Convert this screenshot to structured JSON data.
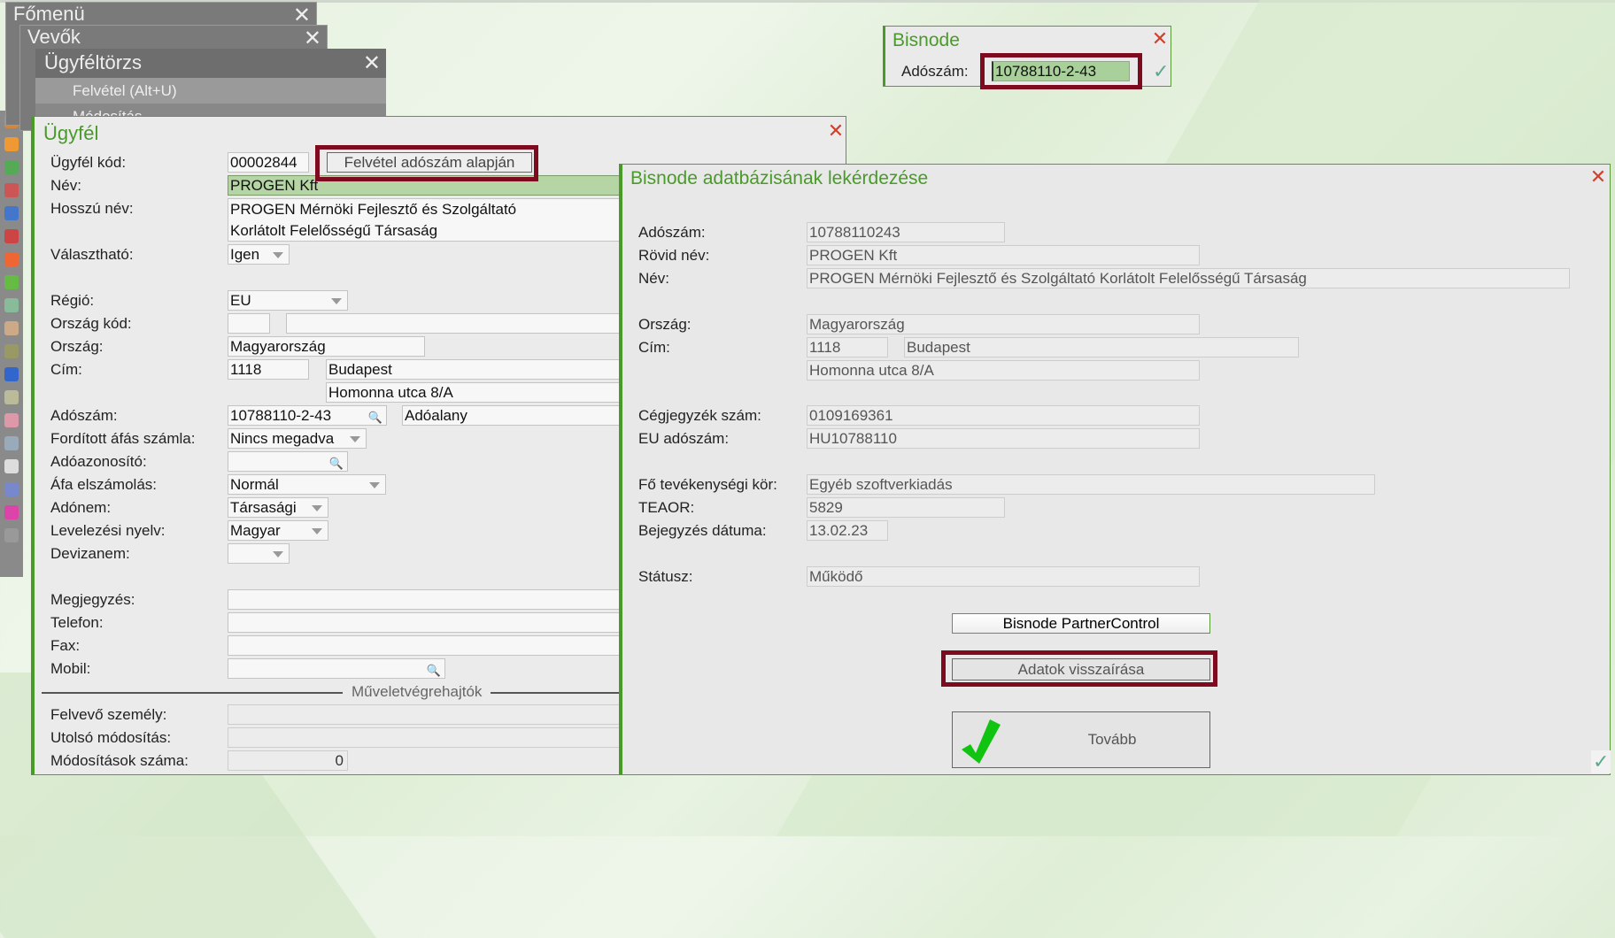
{
  "menus": {
    "main": "Főmenü",
    "customers": "Vevők",
    "registry": "Ügyféltörzs",
    "add": "Felvétel (Alt+U)",
    "edit": "Módosítás"
  },
  "client": {
    "title": "Ügyfél",
    "labels": {
      "code": "Ügyfél kód:",
      "name": "Név:",
      "long_name": "Hosszú név:",
      "selectable": "Választható:",
      "region": "Régió:",
      "country_code": "Ország kód:",
      "country": "Ország:",
      "address": "Cím:",
      "tax": "Adószám:",
      "reverse_vat": "Fordított áfás számla:",
      "tax_id": "Adóazonosító:",
      "vat_settle": "Áfa elszámolás:",
      "tax_type": "Adónem:",
      "lang": "Levelezési nyelv:",
      "currency": "Devizanem:",
      "note": "Megjegyzés:",
      "phone": "Telefon:",
      "fax": "Fax:",
      "mobile": "Mobil:",
      "creator": "Felvevő személy:",
      "last_mod": "Utolsó módosítás:",
      "mod_count": "Módosítások száma:"
    },
    "values": {
      "code": "00002844",
      "name": "PROGEN Kft",
      "long_name_1": "PROGEN Mérnöki Fejlesztő és Szolgáltató",
      "long_name_2": "Korlátolt Felelősségű Társaság",
      "selectable": "Igen",
      "region": "EU",
      "country": "Magyarország",
      "zip": "1118",
      "city": "Budapest",
      "street": "Homonna utca 8/A",
      "tax": "10788110-2-43",
      "tax_status": "Adóalany",
      "reverse_vat": "Nincs megadva",
      "vat_settle": "Normál",
      "tax_type": "Társasági",
      "lang": "Magyar",
      "mod_count": "0"
    },
    "add_by_tax_button": "Felvétel adószám alapján",
    "separator": "Műveletvégrehajtók"
  },
  "bisnode_small": {
    "title": "Bisnode",
    "label": "Adószám:",
    "value": "10788110-2-43"
  },
  "query": {
    "title": "Bisnode adatbázisának lekérdezése",
    "labels": {
      "tax": "Adószám:",
      "short": "Rövid név:",
      "name": "Név:",
      "country": "Ország:",
      "address": "Cím:",
      "reg": "Cégjegyzék szám:",
      "eu": "EU adószám:",
      "activity": "Fő tevékenységi kör:",
      "teaor": "TEAOR:",
      "date": "Bejegyzés dátuma:",
      "status": "Státusz:"
    },
    "values": {
      "tax": "10788110243",
      "short": "PROGEN Kft",
      "name": "PROGEN Mérnöki Fejlesztő és Szolgáltató Korlátolt Felelősségű Társaság",
      "country": "Magyarország",
      "zip": "1118",
      "city": "Budapest",
      "street": "Homonna utca 8/A",
      "reg": "0109169361",
      "eu": "HU10788110",
      "activity": "Egyéb szoftverkiadás",
      "teaor": "5829",
      "date": "13.02.23",
      "status": "Működő"
    },
    "partner_button": "Bisnode PartnerControl",
    "writeback_button": "Adatok visszaírása",
    "next_button": "Tovább"
  },
  "colors": {
    "accent": "#4a9a2a",
    "highlight": "#7d0a1e",
    "close": "#d0402a"
  }
}
